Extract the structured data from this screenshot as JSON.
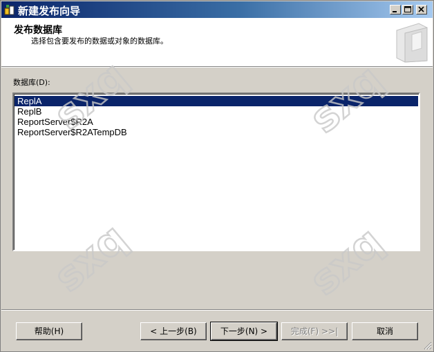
{
  "window": {
    "title": "新建发布向导"
  },
  "header": {
    "title": "发布数据库",
    "subtitle": "选择包含要发布的数据或对象的数据库。"
  },
  "database_list": {
    "label": "数据库(D):",
    "items": [
      {
        "name": "ReplA",
        "selected": true
      },
      {
        "name": "ReplB",
        "selected": false
      },
      {
        "name": "ReportServer$R2A",
        "selected": false
      },
      {
        "name": "ReportServer$R2ATempDB",
        "selected": false
      }
    ]
  },
  "buttons": {
    "help": "帮助(H)",
    "back": "< 上一步(B)",
    "next": "下一步(N) >",
    "finish": "完成(F) >>|",
    "cancel": "取消"
  },
  "watermark": "sxq"
}
